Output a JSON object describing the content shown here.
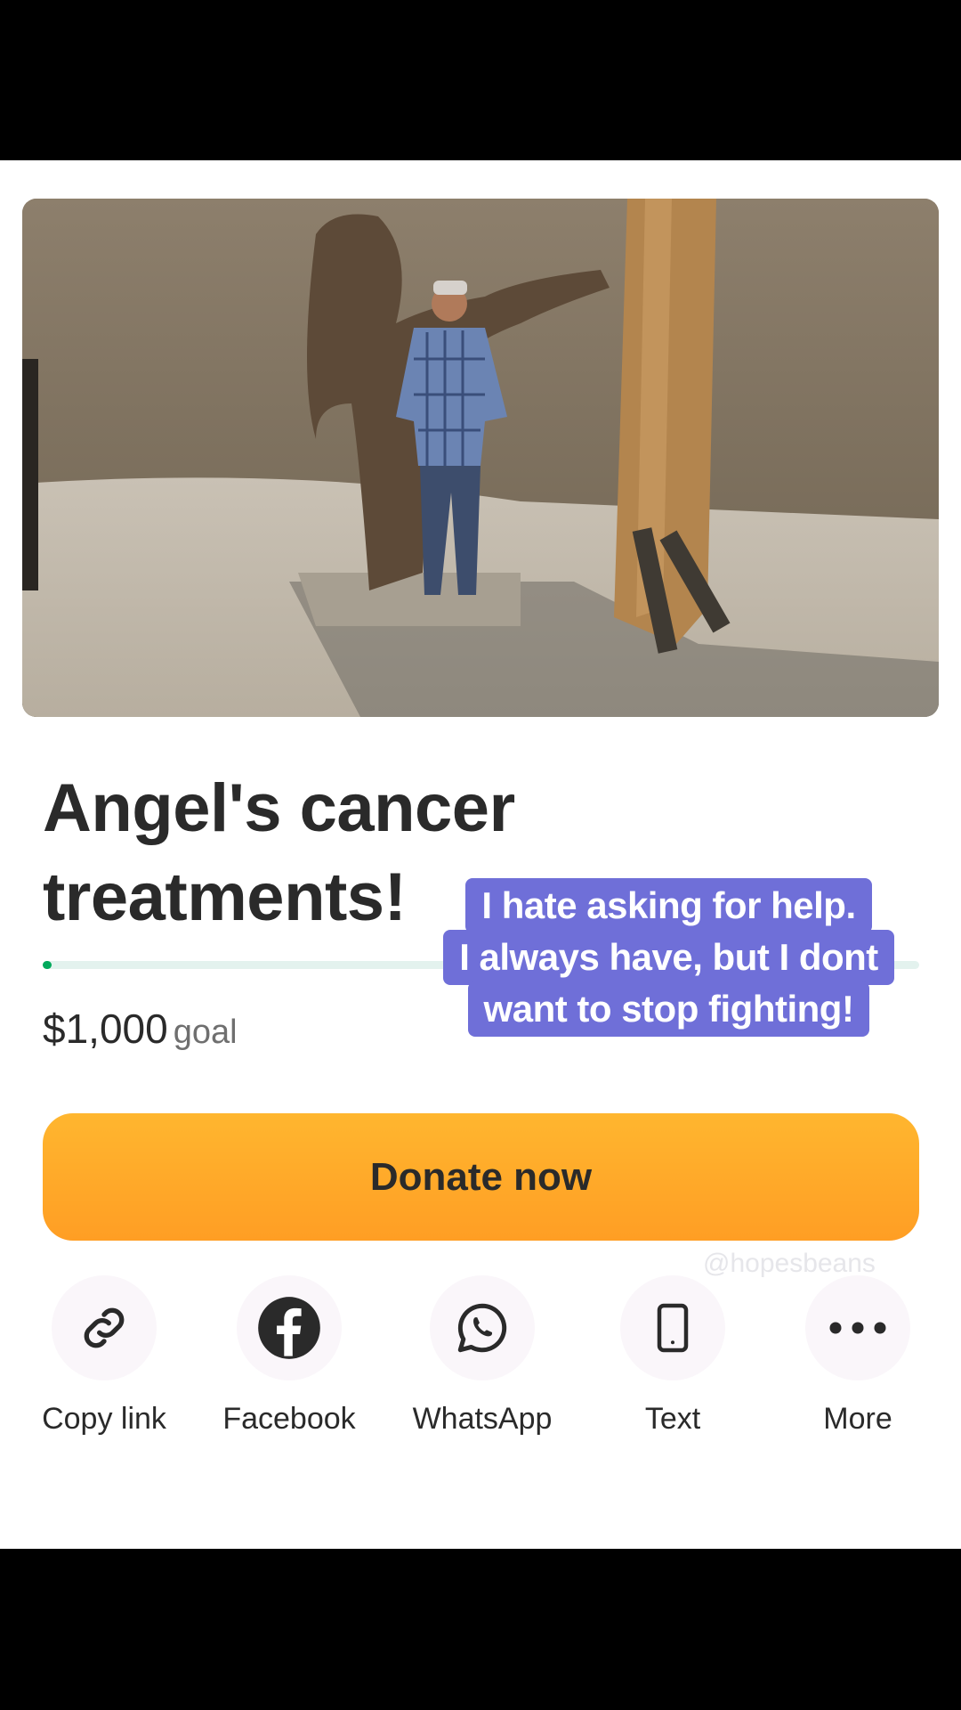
{
  "campaign": {
    "title": "Angel's cancer treatments!",
    "goal_amount": "$1,000",
    "goal_label": "goal",
    "progress_fraction": 0.01
  },
  "caption": {
    "lines": [
      "I hate asking for help.",
      "I always have, but I dont",
      "want to stop fighting!"
    ]
  },
  "donate_button": {
    "label": "Donate now"
  },
  "watermark": {
    "text": "@hopesbeans"
  },
  "share": [
    {
      "label": "Copy link",
      "icon": "link-icon"
    },
    {
      "label": "Facebook",
      "icon": "facebook-icon"
    },
    {
      "label": "WhatsApp",
      "icon": "whatsapp-icon"
    },
    {
      "label": "Text",
      "icon": "phone-icon"
    },
    {
      "label": "More",
      "icon": "more-dots-icon"
    }
  ],
  "colors": {
    "accent_green": "#02a95c",
    "donate_orange": "#ffa828",
    "caption_purple": "#6f6fd8"
  }
}
